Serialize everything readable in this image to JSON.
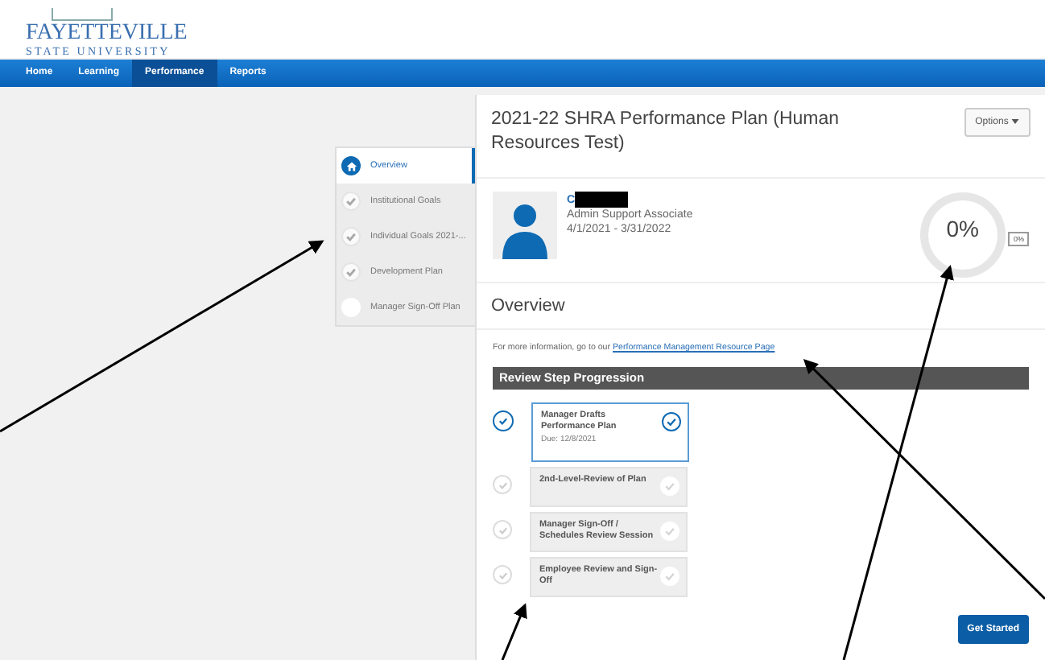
{
  "header": {
    "logo_name": "FAYETTEVILLE",
    "logo_subtitle": "STATE UNIVERSITY"
  },
  "nav": [
    {
      "label": "Home",
      "selected": false
    },
    {
      "label": "Learning",
      "selected": false
    },
    {
      "label": "Performance",
      "selected": true
    },
    {
      "label": "Reports",
      "selected": false
    }
  ],
  "steps": [
    {
      "label": "Overview",
      "kind": "home",
      "selected": true,
      "completed": false
    },
    {
      "label": "Institutional Goals",
      "kind": "step",
      "selected": false,
      "completed": true
    },
    {
      "label": "Individual Goals 2021-...",
      "kind": "step",
      "selected": false,
      "completed": true
    },
    {
      "label": "Development Plan",
      "kind": "step",
      "selected": false,
      "completed": true
    },
    {
      "label": "Manager Sign-Off Plan",
      "kind": "step",
      "selected": false,
      "completed": false
    }
  ],
  "plan": {
    "title": "2021-22 SHRA Performance Plan (Human Resources Test)",
    "options_button": "Options",
    "employee": {
      "name": "C",
      "name_redacted": true,
      "job_title": "Admin Support Associate",
      "dates": "4/1/2021 - 3/31/2022"
    },
    "progress": {
      "level": 0,
      "label": "0%",
      "badge": "0%"
    }
  },
  "overview": {
    "heading": "Overview",
    "info_text": "For more information, go to our ",
    "info_link": "Performance Management Resource Page",
    "progression_heading": "Review Step Progression",
    "review_steps": [
      {
        "title": "Manager Drafts Performance Plan",
        "due": "Due: 12/8/2021",
        "selected": true
      },
      {
        "title": "2nd-Level-Review of Plan",
        "selected": false
      },
      {
        "title": "Manager Sign-Off / Schedules Review Session",
        "selected": false
      },
      {
        "title": "Employee Review and Sign-Off",
        "selected": false
      }
    ],
    "get_started_button": "Get Started"
  }
}
